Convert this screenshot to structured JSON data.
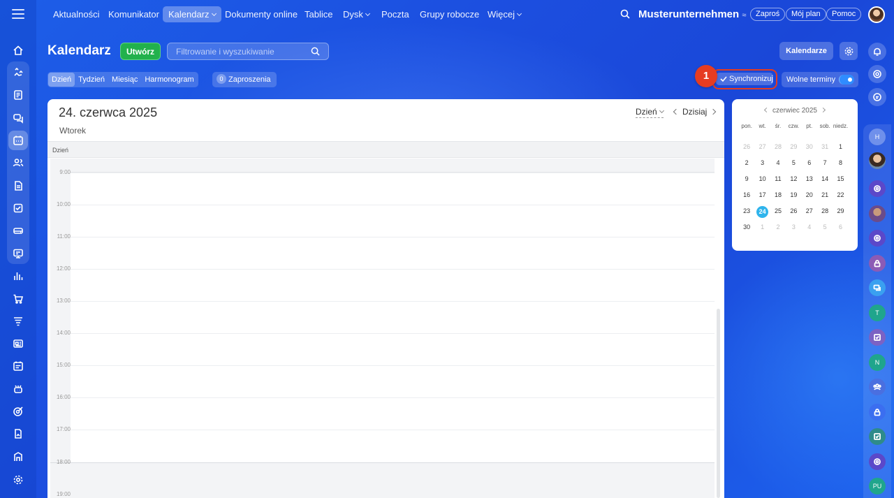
{
  "topnav": {
    "items": [
      "Aktualności",
      "Komunikator",
      "Kalendarz",
      "Dokumenty online",
      "Tablice",
      "Dysk",
      "Poczta",
      "Grupy robocze",
      "Więcej"
    ],
    "company": "Musterunternehmen",
    "invite": "Zaproś",
    "my_plan": "Mój plan",
    "help": "Pomoc"
  },
  "header": {
    "title": "Kalendarz",
    "create": "Utwórz",
    "search_placeholder": "Filtrowanie i wyszukiwanie",
    "calendars": "Kalendarze"
  },
  "views": {
    "tabs": [
      "Dzień",
      "Tydzień",
      "Miesiąc",
      "Harmonogram"
    ],
    "invites_count": "0",
    "invites_label": "Zaproszenia",
    "sync": "Synchronizuj",
    "step_badge": "1",
    "free_slots": "Wolne terminy"
  },
  "day_view": {
    "date": "24. czerwca 2025",
    "weekday": "Wtorek",
    "view_select": "Dzień",
    "today": "Dzisiaj",
    "column_label": "Dzień",
    "hours": [
      "9:00",
      "10:00",
      "11:00",
      "12:00",
      "13:00",
      "14:00",
      "15:00",
      "16:00",
      "17:00",
      "18:00",
      "19:00"
    ]
  },
  "mini_calendar": {
    "month": "czerwiec 2025",
    "weekdays": [
      "pon.",
      "wt.",
      "śr.",
      "czw.",
      "pt.",
      "sob.",
      "niedz."
    ],
    "days": [
      [
        "26",
        "27",
        "28",
        "29",
        "30",
        "31",
        "1"
      ],
      [
        "2",
        "3",
        "4",
        "5",
        "6",
        "7",
        "8"
      ],
      [
        "9",
        "10",
        "11",
        "12",
        "13",
        "14",
        "15"
      ],
      [
        "16",
        "17",
        "18",
        "19",
        "20",
        "21",
        "22"
      ],
      [
        "23",
        "24",
        "25",
        "26",
        "27",
        "28",
        "29"
      ],
      [
        "30",
        "1",
        "2",
        "3",
        "4",
        "5",
        "6"
      ]
    ],
    "today": "24"
  },
  "rightbar": {
    "initials": [
      "H",
      "T",
      "N",
      "PU"
    ]
  },
  "colors": {
    "accent_green": "#22b14c",
    "highlight_red": "#e53b1f",
    "today_blue": "#2fb4ec"
  }
}
